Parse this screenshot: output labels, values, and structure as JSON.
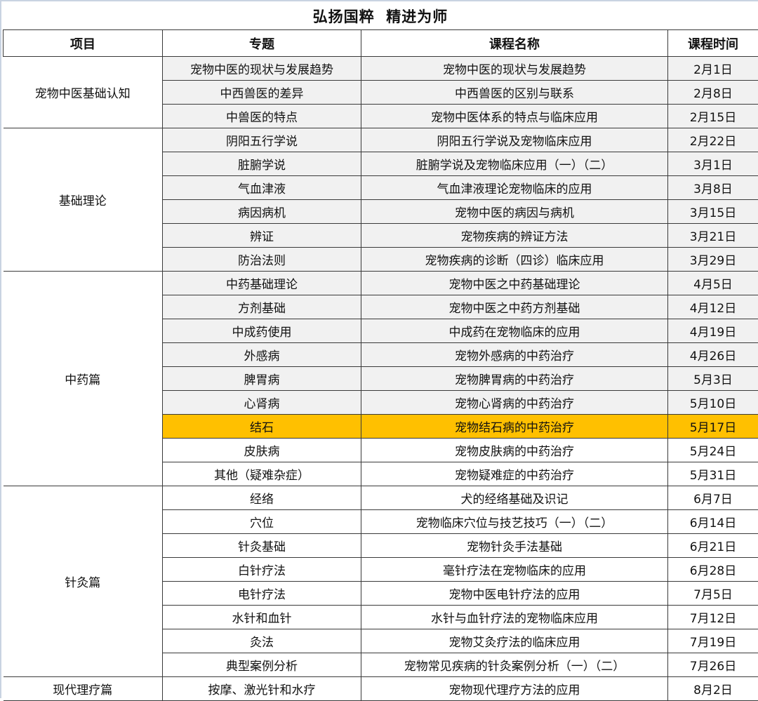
{
  "title": "弘扬国粹  精进为师",
  "headers": [
    "项目",
    "专题",
    "课程名称",
    "课程时间"
  ],
  "highlight_color": "#ffc000",
  "shade_color": "#f1f1f1",
  "groups": [
    {
      "name": "宠物中医基础认知",
      "rows": [
        {
          "topic": "宠物中医的现状与发展趋势",
          "course": "宠物中医的现状与发展趋势",
          "date": "2月1日",
          "style": "shaded"
        },
        {
          "topic": "中西兽医的差异",
          "course": "中西兽医的区别与联系",
          "date": "2月8日",
          "style": "shaded"
        },
        {
          "topic": "中兽医的特点",
          "course": "宠物中医体系的特点与临床应用",
          "date": "2月15日",
          "style": "shaded"
        }
      ]
    },
    {
      "name": "基础理论",
      "rows": [
        {
          "topic": "阴阳五行学说",
          "course": "阴阳五行学说及宠物临床应用",
          "date": "2月22日",
          "style": "shaded"
        },
        {
          "topic": "脏腑学说",
          "course": "脏腑学说及宠物临床应用（一）（二）",
          "date": "3月1日",
          "style": "shaded"
        },
        {
          "topic": "气血津液",
          "course": "气血津液理论宠物临床的应用",
          "date": "3月8日",
          "style": "shaded"
        },
        {
          "topic": "病因病机",
          "course": "宠物中医的病因与病机",
          "date": "3月15日",
          "style": "shaded"
        },
        {
          "topic": "辨证",
          "course": "宠物疾病的辨证方法",
          "date": "3月21日",
          "style": "shaded"
        },
        {
          "topic": "防治法则",
          "course": "宠物疾病的诊断（四诊）临床应用",
          "date": "3月29日",
          "style": "shaded"
        }
      ]
    },
    {
      "name": "中药篇",
      "rows": [
        {
          "topic": "中药基础理论",
          "course": "宠物中医之中药基础理论",
          "date": "4月5日",
          "style": "shaded"
        },
        {
          "topic": "方剂基础",
          "course": "宠物中医之中药方剂基础",
          "date": "4月12日",
          "style": "shaded"
        },
        {
          "topic": "中成药使用",
          "course": "中成药在宠物临床的应用",
          "date": "4月19日",
          "style": "shaded"
        },
        {
          "topic": "外感病",
          "course": "宠物外感病的中药治疗",
          "date": "4月26日",
          "style": "shaded"
        },
        {
          "topic": "脾胃病",
          "course": "宠物脾胃病的中药治疗",
          "date": "5月3日",
          "style": "shaded"
        },
        {
          "topic": "心肾病",
          "course": "宠物心肾病的中药治疗",
          "date": "5月10日",
          "style": "shaded"
        },
        {
          "topic": "结石",
          "course": "宠物结石病的中药治疗",
          "date": "5月17日",
          "style": "hl"
        },
        {
          "topic": "皮肤病",
          "course": "宠物皮肤病的中药治疗",
          "date": "5月24日",
          "style": "plain"
        },
        {
          "topic": "其他（疑难杂症）",
          "course": "宠物疑难症的中药治疗",
          "date": "5月31日",
          "style": "plain"
        }
      ]
    },
    {
      "name": "针灸篇",
      "rows": [
        {
          "topic": "经络",
          "course": "犬的经络基础及识记",
          "date": "6月7日",
          "style": "plain"
        },
        {
          "topic": "穴位",
          "course": "宠物临床穴位与技艺技巧（一）（二）",
          "date": "6月14日",
          "style": "plain"
        },
        {
          "topic": "针灸基础",
          "course": "宠物针灸手法基础",
          "date": "6月21日",
          "style": "plain"
        },
        {
          "topic": "白针疗法",
          "course": "毫针疗法在宠物临床的应用",
          "date": "6月28日",
          "style": "plain"
        },
        {
          "topic": "电针疗法",
          "course": "宠物中医电针疗法的应用",
          "date": "7月5日",
          "style": "plain"
        },
        {
          "topic": "水针和血针",
          "course": "水针与血针疗法的宠物临床应用",
          "date": "7月12日",
          "style": "plain"
        },
        {
          "topic": "灸法",
          "course": "宠物艾灸疗法的临床应用",
          "date": "7月19日",
          "style": "plain"
        },
        {
          "topic": "典型案例分析",
          "course": "宠物常见疾病的针灸案例分析（一）（二）",
          "date": "7月26日",
          "style": "plain"
        }
      ]
    },
    {
      "name": "现代理疗篇",
      "rows": [
        {
          "topic": "按摩、激光针和水疗",
          "course": "宠物现代理疗方法的应用",
          "date": "8月2日",
          "style": "plain"
        }
      ]
    }
  ]
}
